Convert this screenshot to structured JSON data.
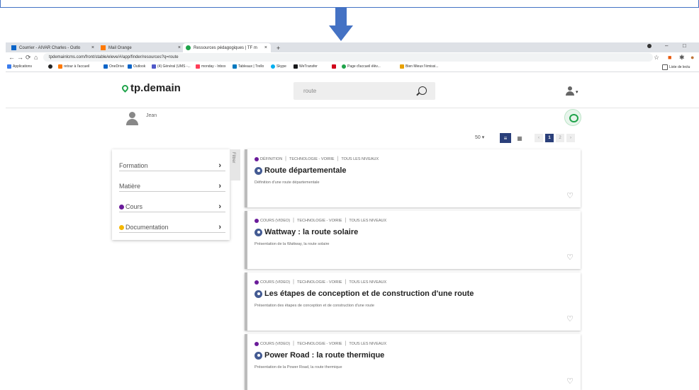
{
  "browser": {
    "tabs": [
      {
        "label": "Courrier - AIVAR Charles - Outlo",
        "close": "×"
      },
      {
        "label": "Mail Orange",
        "close": "×"
      },
      {
        "label": "Ressources pédagogiques | TF m",
        "close": "×"
      }
    ],
    "new_tab": "+",
    "window_controls": {
      "minimize": "–",
      "maximize": "□"
    },
    "url": "tpdemainlcms.com/front/stable/eleve/#/app/finder/resources?q=route",
    "bookmarks": [
      "Applications",
      "retour à l'accueil",
      "OneDrive",
      "Outlook",
      "(4) Général (UMS -...",
      "monday - Inbox",
      "Tableaux | Trello",
      "Skype",
      "WeTransfer",
      "Page d'accueil élèv...",
      "Bien Mieux l'émissi..."
    ],
    "reading_list": "Liste de lectu"
  },
  "app": {
    "logo": "tp.demain",
    "search_value": "route",
    "user_name": "Jean"
  },
  "toolbar": {
    "per_page": "50",
    "pagination": {
      "prev": "‹",
      "pages": [
        "1",
        "2"
      ],
      "next": "›",
      "current": "1"
    }
  },
  "filters": {
    "tab_label": "Filtrer",
    "items": [
      {
        "label": "Formation",
        "dot": ""
      },
      {
        "label": "Matière",
        "dot": ""
      },
      {
        "label": "Cours",
        "dot": "#6a1b9a"
      },
      {
        "label": "Documentation",
        "dot": "#f5b700"
      }
    ]
  },
  "results": [
    {
      "type": "DÉFINITION",
      "category": "TECHNOLOGIE - VOIRIE",
      "level": "TOUS LES NIVEAUX",
      "title": "Route départementale",
      "description": "Définition d'une route départementale"
    },
    {
      "type": "COURS (VIDEO)",
      "category": "TECHNOLOGIE - VOIRIE",
      "level": "TOUS LES NIVEAUX",
      "title": "Wattway : la route solaire",
      "description": "Présentation de la Wattway, la route solaire"
    },
    {
      "type": "COURS (VIDEO)",
      "category": "TECHNOLOGIE - VOIRIE",
      "level": "TOUS LES NIVEAUX",
      "title": "Les étapes de conception et de construction d'une route",
      "description": "Présentation des étapes de conception et de construction d'une route"
    },
    {
      "type": "COURS (VIDEO)",
      "category": "TECHNOLOGIE - VOIRIE",
      "level": "TOUS LES NIVEAUX",
      "title": "Power Road : la route thermique",
      "description": "Présentation de la Power Road, la route thermique"
    }
  ],
  "colors": {
    "accent": "#1fa34a",
    "cours": "#6a1b9a",
    "documentation": "#f5b700",
    "annotation": "#4472c4",
    "pagination_active": "#2a3f7a"
  }
}
